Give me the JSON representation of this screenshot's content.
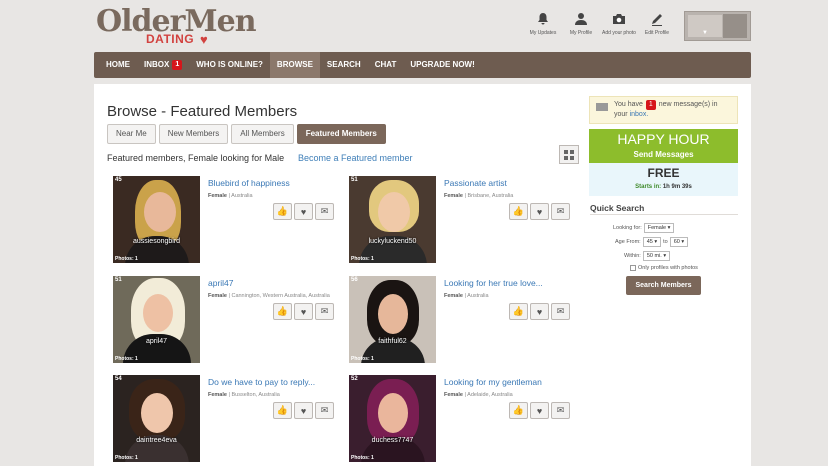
{
  "logo": {
    "text1": "OlderMen",
    "text2": "DATING"
  },
  "top_icons": [
    {
      "label": "My Updates",
      "icon": "bell-icon"
    },
    {
      "label": "My Profile",
      "icon": "user-icon"
    },
    {
      "label": "Add your photo",
      "icon": "camera-icon"
    },
    {
      "label": "Edit Profile",
      "icon": "pencil-icon"
    }
  ],
  "nav": {
    "home": "HOME",
    "inbox": "INBOX",
    "inbox_count": "1",
    "online": "WHO IS ONLINE?",
    "browse": "BROWSE",
    "search": "SEARCH",
    "chat": "CHAT",
    "upgrade": "UPGRADE NOW!"
  },
  "page": {
    "title": "Browse - Featured Members",
    "tabs": [
      "Near Me",
      "New Members",
      "All Members",
      "Featured Members"
    ],
    "subtitle": "Featured members, Female looking for Male",
    "featured_link": "Become a Featured member"
  },
  "members": [
    {
      "num": "45",
      "username": "aussiesongbird",
      "photos": "Photos: 1",
      "title": "Bluebird of happiness",
      "gender": "Female",
      "location": "Australia"
    },
    {
      "num": "51",
      "username": "luckyluckend50",
      "photos": "Photos: 1",
      "title": "Passionate artist",
      "gender": "Female",
      "location": "Brisbane, Australia"
    },
    {
      "num": "51",
      "username": "april47",
      "photos": "Photos: 1",
      "title": "april47",
      "gender": "Female",
      "location": "Cannington, Western Australia, Australia"
    },
    {
      "num": "56",
      "username": "faithful62",
      "photos": "Photos: 1",
      "title": "Looking for her true love...",
      "gender": "Female",
      "location": "Australia"
    },
    {
      "num": "54",
      "username": "daintree4eva",
      "photos": "Photos: 1",
      "title": "Do we have to pay to reply...",
      "gender": "Female",
      "location": "Busselton, Australia"
    },
    {
      "num": "52",
      "username": "duchess7747",
      "photos": "Photos: 1",
      "title": "Looking for my gentleman",
      "gender": "Female",
      "location": "Adelaide, Australia"
    }
  ],
  "sidebar": {
    "msg_pre": "You have",
    "msg_count": "1",
    "msg_post": "new message(s) in your",
    "msg_link": "inbox.",
    "happy_hour": "HAPPY HOUR",
    "send_messages": "Send Messages",
    "free": "FREE",
    "starts_label": "Starts in:",
    "starts_time": "1h 9m 39s",
    "quick_search": "Quick Search",
    "looking_for_label": "Looking for:",
    "looking_for_value": "Female",
    "age_from_label": "Age From:",
    "age_from_value": "45",
    "age_to_label": "to",
    "age_to_value": "60",
    "within_label": "Within:",
    "within_value": "50 mi.",
    "only_photos": "Only profiles with photos",
    "search_button": "Search Members"
  },
  "colors": {
    "nav_bg": "#6e5c50",
    "accent_brown": "#7b675a",
    "link_blue": "#3a78b5",
    "badge_red": "#d6161b",
    "happy_green": "#8dbd2c"
  }
}
